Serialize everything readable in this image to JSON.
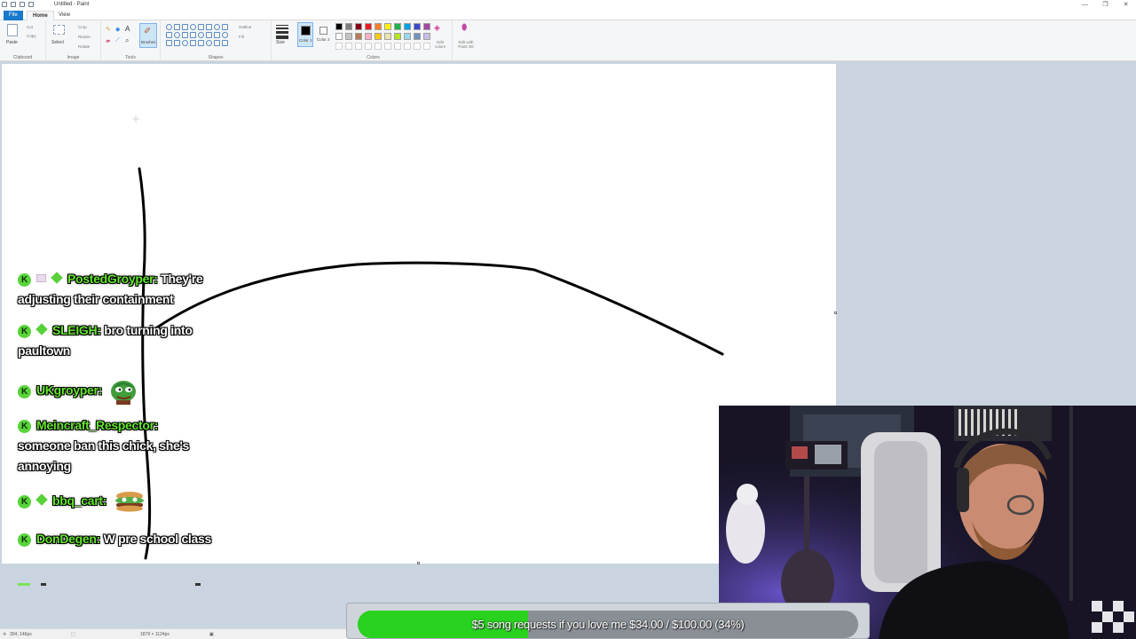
{
  "window": {
    "title": "Untitled - Paint",
    "controls": [
      "—",
      "❐",
      "✕"
    ]
  },
  "tabs": [
    {
      "label": "File",
      "active": false
    },
    {
      "label": "Home",
      "active": true
    },
    {
      "label": "View",
      "active": false
    }
  ],
  "ribbon": {
    "clipboard": {
      "label": "Clipboard",
      "paste": "Paste",
      "cut": "Cut",
      "copy": "Copy"
    },
    "image": {
      "label": "Image",
      "select": "Select",
      "crop": "Crop",
      "resize": "Resize",
      "rotate": "Rotate"
    },
    "tools": {
      "label": "Tools",
      "brushes": "Brushes"
    },
    "shapes": {
      "label": "Shapes",
      "outline": "Outline",
      "fill": "Fill"
    },
    "size": {
      "label": "Size"
    },
    "colors": {
      "label": "Colors",
      "color1": "Color 1",
      "color2": "Color 2",
      "edit": "Edit colors",
      "paint3d": "Edit with Paint 3D",
      "palette_top": [
        "#000000",
        "#7f7f7f",
        "#880015",
        "#ed1c24",
        "#ff7f27",
        "#fff200",
        "#22b14c",
        "#00a2e8",
        "#3f48cc",
        "#a349a4"
      ],
      "palette_bottom": [
        "#ffffff",
        "#c3c3c3",
        "#b97a57",
        "#ffaec9",
        "#ffc90e",
        "#efe4b0",
        "#b5e61d",
        "#99d9ea",
        "#7092be",
        "#c8bfe7"
      ]
    }
  },
  "statusbar": {
    "cursor": "304, 146px",
    "size": "1879 × 1124px"
  },
  "chat": [
    {
      "user": "PostedGroyper:",
      "text": "They're adjusting their containment",
      "badges": [
        "k",
        "sub",
        "gem"
      ]
    },
    {
      "user": "SLEIGH:",
      "text": "bro turning into paultown",
      "badges": [
        "k",
        "gem"
      ]
    },
    {
      "user": "UKgroyper:",
      "text": "",
      "badges": [
        "k"
      ],
      "emote": "pepe"
    },
    {
      "user": "Meincraft_Respector:",
      "text": "someone ban this chick, she's annoying",
      "badges": [
        "k"
      ]
    },
    {
      "user": "bbq_cart:",
      "text": "",
      "badges": [
        "k",
        "gem"
      ],
      "emote": "pepe-burger"
    },
    {
      "user": "DonDegen:",
      "text": "W pre school class",
      "badges": [
        "k"
      ]
    }
  ],
  "goal": {
    "text": "$5 song requests if you love me $34.00 / $100.00 (34%)",
    "progress": 0.34,
    "fill_color": "#29d21f"
  }
}
